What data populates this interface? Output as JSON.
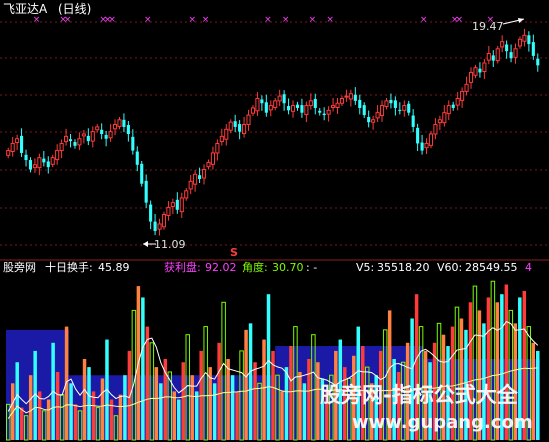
{
  "header": {
    "title": "飞亚达A",
    "period": "(日线)"
  },
  "indicator_bar": {
    "source": "股旁网",
    "indicator_name": "十日换手:",
    "indicator_value": "45.89",
    "profit_label": "获利盘:",
    "profit_value": "92.02",
    "angle_label": "角度:",
    "angle_value": "30.70",
    "angle_suffix": ": -",
    "v5_label": "V5:",
    "v5_value": "35518.20",
    "v60_label": "V60:",
    "v60_value": "28549.55",
    "tail": "4"
  },
  "annotations": {
    "high_label": "19.47",
    "low_label": "11.09",
    "signal_marker": "S"
  },
  "watermark": {
    "line1": "股旁网-指标公式大全",
    "line2": "www.gupang.com"
  },
  "colors": {
    "up": "#ff3b3b",
    "down": "#33ffff",
    "panel_fill": "#1a1aa6",
    "ma_line": "#ffffff",
    "slow_line": "#ffffa0",
    "magenta": "#ff40ff",
    "green": "#7cfc00"
  },
  "chart_data": [
    {
      "type": "candlestick",
      "title": "飞亚达A (日线)",
      "y_high": 19.47,
      "y_low": 11.09,
      "ylim": [
        10.4,
        20.2
      ],
      "grid": true,
      "closes": [
        14.6,
        14.9,
        15.1,
        14.5,
        14.2,
        13.8,
        14.0,
        14.3,
        14.1,
        13.9,
        14.3,
        14.6,
        14.9,
        15.2,
        15.0,
        14.8,
        15.1,
        15.3,
        15.0,
        15.4,
        15.6,
        15.3,
        15.1,
        15.4,
        15.7,
        15.9,
        15.6,
        15.3,
        14.6,
        14.0,
        13.2,
        12.4,
        11.6,
        11.2,
        11.5,
        11.9,
        12.2,
        12.4,
        12.1,
        12.6,
        12.9,
        13.3,
        13.6,
        13.4,
        13.8,
        14.1,
        14.5,
        14.9,
        15.2,
        15.5,
        15.8,
        15.6,
        15.4,
        15.7,
        16.1,
        16.4,
        16.8,
        16.6,
        16.2,
        16.5,
        16.7,
        16.9,
        16.6,
        16.3,
        16.5,
        16.4,
        16.2,
        16.5,
        16.7,
        16.4,
        16.2,
        16.1,
        16.3,
        16.5,
        16.6,
        16.8,
        16.9,
        17.0,
        16.7,
        16.4,
        16.1,
        15.8,
        15.9,
        16.2,
        16.5,
        16.7,
        16.6,
        16.4,
        16.3,
        16.5,
        16.2,
        15.6,
        14.9,
        14.6,
        14.9,
        15.3,
        15.7,
        15.9,
        16.2,
        16.5,
        16.4,
        16.8,
        17.1,
        17.4,
        17.9,
        18.1,
        17.9,
        18.3,
        18.7,
        18.4,
        18.9,
        19.2,
        18.8,
        18.5,
        18.9,
        19.3,
        19.47,
        19.1,
        18.6,
        18.2
      ]
    },
    {
      "type": "bar",
      "title": "十日换手",
      "series": [
        {
          "name": "十日换手",
          "last": 45.89
        },
        {
          "name": "获利盘",
          "last": 92.02
        },
        {
          "name": "角度",
          "last": 30.7
        },
        {
          "name": "V5",
          "last": 35518.2
        },
        {
          "name": "V60",
          "last": 28549.55
        }
      ],
      "turnover": [
        22,
        35,
        48,
        20,
        15,
        40,
        55,
        30,
        18,
        25,
        60,
        42,
        28,
        70,
        35,
        22,
        18,
        50,
        45,
        30,
        20,
        38,
        62,
        25,
        15,
        28,
        40,
        55,
        80,
        95,
        88,
        70,
        60,
        45,
        35,
        50,
        42,
        30,
        25,
        48,
        65,
        40,
        30,
        55,
        70,
        45,
        35,
        60,
        85,
        50,
        40,
        30,
        55,
        68,
        72,
        48,
        35,
        62,
        90,
        55,
        40,
        30,
        45,
        58,
        70,
        42,
        35,
        50,
        65,
        48,
        38,
        30,
        40,
        55,
        62,
        45,
        38,
        52,
        70,
        58,
        45,
        35,
        40,
        55,
        68,
        80,
        50,
        42,
        48,
        60,
        75,
        90,
        70,
        55,
        48,
        60,
        72,
        65,
        58,
        70,
        82,
        75,
        68,
        85,
        95,
        80,
        72,
        88,
        98,
        85,
        90,
        96,
        80,
        72,
        88,
        92,
        70,
        60,
        55
      ],
      "band_level": [
        68,
        68,
        68,
        68,
        68,
        68,
        68,
        68,
        68,
        68,
        68,
        68,
        68,
        68,
        40,
        40,
        40,
        40,
        40,
        40,
        40,
        40,
        40,
        40,
        40,
        40,
        40,
        40,
        40,
        40,
        40,
        40,
        40,
        40,
        40,
        40,
        40,
        40,
        40,
        40,
        40,
        40,
        40,
        40,
        40,
        40,
        40,
        40,
        40,
        40,
        40,
        40,
        40,
        40,
        40,
        40,
        40,
        40,
        40,
        40,
        58,
        58,
        58,
        58,
        58,
        58,
        58,
        58,
        58,
        58,
        58,
        58,
        58,
        58,
        58,
        58,
        58,
        58,
        58,
        58,
        58,
        58,
        58,
        58,
        58,
        58,
        58,
        58,
        58,
        58,
        58,
        58,
        58,
        50,
        50,
        50,
        50,
        50,
        50,
        50,
        50,
        50,
        50,
        50,
        50,
        50,
        50,
        50,
        50,
        50,
        50,
        50,
        50,
        50,
        50,
        50,
        50,
        50,
        50
      ],
      "ylim": [
        0,
        100
      ]
    }
  ]
}
